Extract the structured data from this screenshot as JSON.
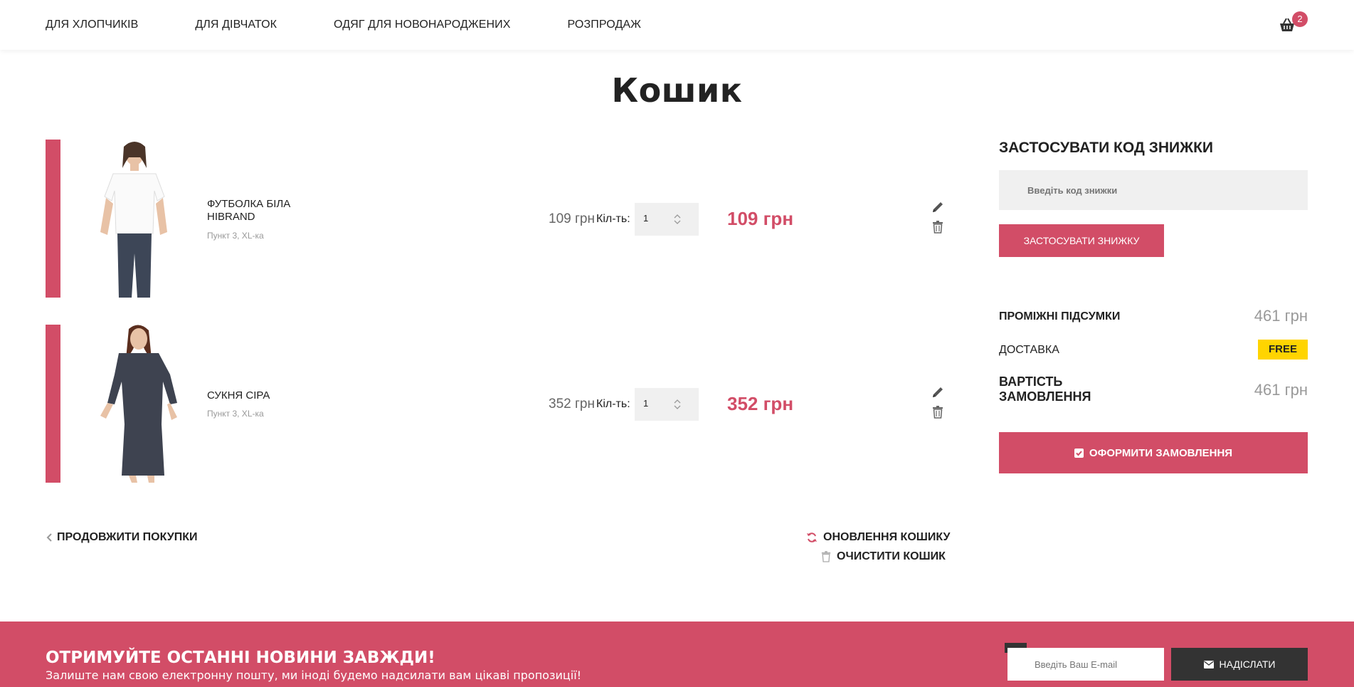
{
  "nav": {
    "items": [
      {
        "label": "ДЛЯ ХЛОПЧИКІВ"
      },
      {
        "label": "ДЛЯ ДІВЧАТОК"
      },
      {
        "label": "ОДЯГ ДЛЯ НОВОНАРОДЖЕНИХ"
      },
      {
        "label": "РОЗПРОДАЖ"
      }
    ],
    "cart_count": "2"
  },
  "page": {
    "title": "Кошик"
  },
  "cart": {
    "qty_label": "Кіл-ть:",
    "items": [
      {
        "name": "ФУТБОЛКА БІЛА HIBRAND",
        "options": "Пункт 3, XL-ка",
        "price": "109 грн",
        "quantity": "1",
        "total": "109 грн"
      },
      {
        "name": "СУКНЯ СІРА",
        "options": "Пункт 3, XL-ка",
        "price": "352 грн",
        "quantity": "1",
        "total": "352 грн"
      }
    ],
    "continue_label": "ПРОДОВЖИТИ ПОКУПКИ",
    "update_label": "ОНОВЛЕННЯ КОШИКУ",
    "clear_label": "ОЧИСТИТИ КОШИК"
  },
  "coupon": {
    "title": "ЗАСТОСУВАТИ КОД ЗНИЖКИ",
    "placeholder": "Введіть код знижки",
    "button_label": "ЗАСТОСУВАТИ ЗНИЖКУ"
  },
  "summary": {
    "subtotal_label": "ПРОМІЖНІ ПІДСУМКИ",
    "subtotal_value": "461 грн",
    "shipping_label": "ДОСТАВКА",
    "shipping_value": "FREE",
    "total_label": "ВАРТІСТЬ ЗАМОВЛЕННЯ",
    "total_value": "461 грн",
    "checkout_label": "ОФОРМИТИ ЗАМОВЛЕННЯ"
  },
  "newsletter": {
    "title": "ОТРИМУЙТЕ ОСТАННІ НОВИНИ ЗАВЖДИ!",
    "subtitle": "Залиште нам свою електронну пошту, ми іноді будемо надсилати вам цікаві пропозиції!",
    "placeholder": "Введіть Ваш E-mail",
    "button_label": "НАДІСЛАТИ"
  },
  "colors": {
    "accent": "#d24d67",
    "free_badge": "#ffd400",
    "dark_button": "#333333"
  },
  "icons": [
    "shopping-basket-icon",
    "pencil-icon",
    "trash-icon",
    "chevron-left-icon",
    "refresh-icon",
    "check-square-icon",
    "envelope-icon",
    "spinner-arrows-icon"
  ]
}
